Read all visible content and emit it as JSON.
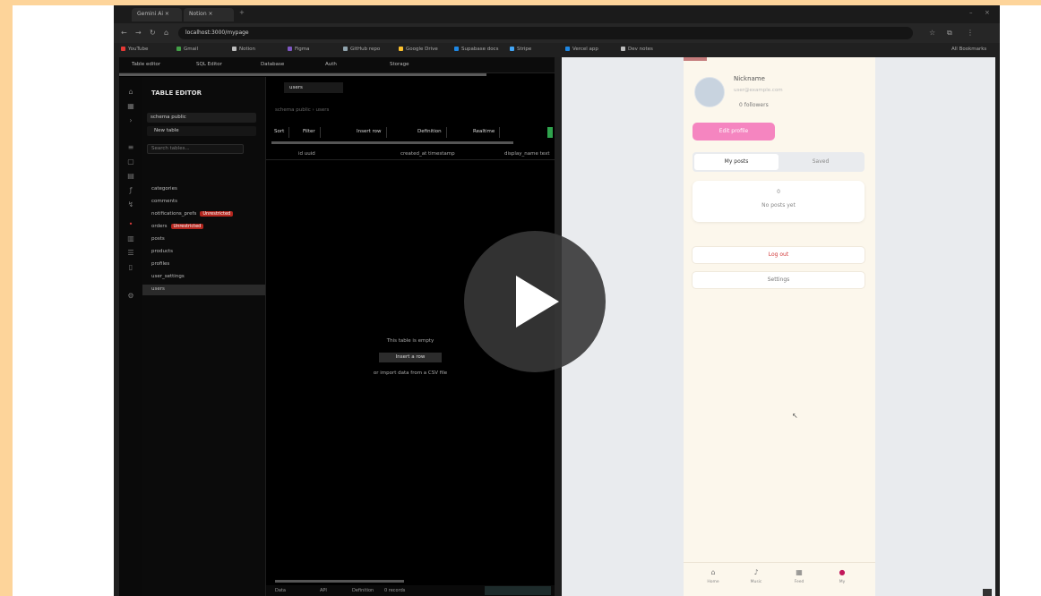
{
  "browser": {
    "tabs": [
      {
        "label": "Gemini Ai ×"
      },
      {
        "label": "Notion ×"
      }
    ],
    "new_tab": "+",
    "url": "localhost:3000/mypage",
    "bookmarks": [
      {
        "label": "YouTube",
        "color": "#e53935"
      },
      {
        "label": "Gmail",
        "color": "#43a047"
      },
      {
        "label": "Notion",
        "color": "#bdbdbd"
      },
      {
        "label": "Figma",
        "color": "#7e57c2"
      },
      {
        "label": "GitHub repo",
        "color": "#90a4ae"
      },
      {
        "label": "Google Drive",
        "color": "#fbc02d"
      },
      {
        "label": "Supabase docs",
        "color": "#1e88e5"
      },
      {
        "label": "Stripe",
        "color": "#42a5f5"
      },
      {
        "label": "Vercel app",
        "color": "#1e88e5"
      },
      {
        "label": "Dev notes",
        "color": "#bdbdbd"
      }
    ],
    "all_bookmarks": "All Bookmarks"
  },
  "editor": {
    "toolbar": [
      "Table editor",
      "SQL Editor",
      "Database",
      "Auth",
      "Storage"
    ],
    "explorer_title": "TABLE EDITOR",
    "schema_select": "schema public",
    "new_table": "New table",
    "filter_placeholder": "Search tables...",
    "tree": [
      {
        "label": "categories"
      },
      {
        "label": "comments"
      },
      {
        "label": "notifications_prefs",
        "badge": "Unrestricted"
      },
      {
        "label": "orders",
        "badge": "Unrestricted"
      },
      {
        "label": "posts"
      },
      {
        "label": "products"
      },
      {
        "label": "profiles"
      },
      {
        "label": "user_settings"
      },
      {
        "label": "users"
      }
    ],
    "tab": "users",
    "breadcrumb": "schema public  ›  users",
    "buttons": [
      "Sort",
      "Filter",
      "Insert row",
      "Definition",
      "Realtime"
    ],
    "columns": [
      "id  uuid",
      "created_at  timestamp",
      "display_name  text"
    ],
    "empty_line1": "This table is empty",
    "empty_button": "Insert a row",
    "empty_line2": "or import data from a CSV file",
    "status": [
      "Data",
      "API",
      "Definition",
      "0 records"
    ]
  },
  "phone": {
    "username": "Nickname",
    "user_sub": "user@example.com",
    "user_info": "0 followers",
    "pink_button": "Edit profile",
    "segments": [
      "My posts",
      "Saved"
    ],
    "card_count": "0",
    "card_label": "No posts yet",
    "logout": "Log out",
    "settings": "Settings",
    "tabbar": [
      {
        "icon": "⌂",
        "label": "Home"
      },
      {
        "icon": "♪",
        "label": "Music"
      },
      {
        "icon": "▦",
        "label": "Feed"
      },
      {
        "icon": "●",
        "label": "My"
      }
    ]
  },
  "colors": {
    "accent_pink": "#f585c0",
    "logout_red": "#d23a3a",
    "badge_red": "#b3261e",
    "frame_orange": "#fdd49a"
  }
}
